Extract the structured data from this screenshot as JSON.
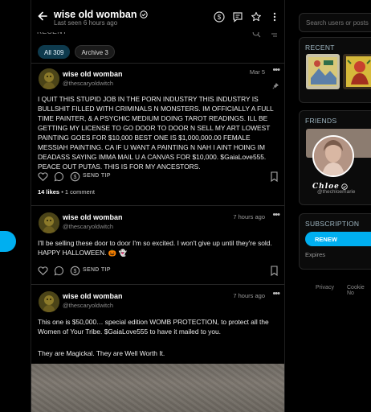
{
  "header": {
    "name": "wise old womban",
    "last_seen": "Last seen 6 hours ago",
    "icons": [
      "back-arrow-icon",
      "dollar-circle-icon",
      "message-icon",
      "star-icon",
      "more-vertical-icon"
    ]
  },
  "feed": {
    "section_label": "RECENT",
    "tabs": [
      {
        "label": "All 309",
        "active": true
      },
      {
        "label": "Archive 3",
        "active": false
      }
    ]
  },
  "posts": [
    {
      "name": "wise old womban",
      "handle": "@thescaryoldwitch",
      "date": "Mar 5",
      "pinned": true,
      "text": "I QUIT THIS STUPID JOB IN THE PORN INDUSTRY THIS INDUSTRY IS BULLSHIT FILLED WITH CRIMINALS N MONSTERS. IM OFFICIALLY A FULL TIME PAINTER, & A PSYCHIC MEDIUM DOING TAROT READINGS. ILL BE GETTING MY LICENSE TO GO DOOR TO DOOR N SELL MY ART LOWEST PAINTING GOES FOR $10,000 BEST ONE IS $1,000,000.00 FEMALE MESSIAH PAINTING. CA IF U WANT A PAINTING N NAH I AINT HOING IM DEADASS SAYING IMMA MAIL U A CANVAS FOR $10,000. $GaiaLove555. PEACE OUT PUTAS. THIS IS FOR MY ANCESTORS.",
      "send_tip": "SEND TIP",
      "likes": "14 likes",
      "comments": "1 comment"
    },
    {
      "name": "wise old womban",
      "handle": "@thescaryoldwitch",
      "date": "7 hours ago",
      "text": "I'll be selling these door to door I'm so excited. I won't give up until they're sold. HAPPY HALLOWEEN. 🎃 👻",
      "send_tip": "SEND TIP"
    },
    {
      "name": "wise old womban",
      "handle": "@thescaryoldwitch",
      "date": "7 hours ago",
      "text_1": "This one is $50,000… special edition WOMB PROTECTION, to protect all the Women of Your Tribe. $GaiaLove555 to have it mailed to you.",
      "text_2": "They are Magickal. They are Well Worth It."
    }
  ],
  "sidebar": {
    "search_placeholder": "Search users or posts",
    "recent_title": "RECENT",
    "friends_title": "FRIENDS",
    "friend_name": "Chloe",
    "friend_handle": "@thechloemarie",
    "subscription_title": "SUBSCRIPTION",
    "renew_label": "RENEW",
    "expires_label": "Expires",
    "footer_links": [
      "Privacy",
      "Cookie No"
    ]
  },
  "colors": {
    "accent": "#00aff0",
    "active_tab": "#0e3a4d",
    "background": "#000000"
  }
}
